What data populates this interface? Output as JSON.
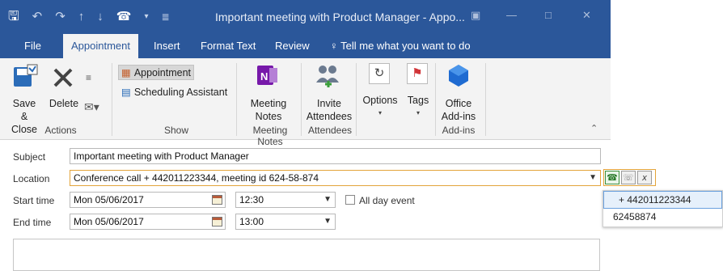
{
  "window": {
    "title": "Important meeting with Product Manager  -  Appo..."
  },
  "tabs": [
    {
      "label": "File"
    },
    {
      "label": "Appointment"
    },
    {
      "label": "Insert"
    },
    {
      "label": "Format Text"
    },
    {
      "label": "Review"
    },
    {
      "label": "Tell me what you want to do"
    }
  ],
  "ribbon": {
    "actions": {
      "save_close_line1": "Save &",
      "save_close_line2": "Close",
      "delete": "Delete",
      "group": "Actions"
    },
    "show": {
      "appointment": "Appointment",
      "scheduling": "Scheduling Assistant",
      "group": "Show"
    },
    "meeting_notes": {
      "line1": "Meeting",
      "line2": "Notes",
      "group": "Meeting Notes"
    },
    "attendees": {
      "line1": "Invite",
      "line2": "Attendees",
      "group": "Attendees"
    },
    "options": {
      "label": "Options"
    },
    "tags": {
      "label": "Tags"
    },
    "addins": {
      "line1": "Office",
      "line2": "Add-ins",
      "group": "Add-ins"
    }
  },
  "form": {
    "subject_label": "Subject",
    "subject_value": "Important meeting with Product Manager",
    "location_label": "Location",
    "location_value": "Conference call + 442011223344, meeting id 624-58-874",
    "start_label": "Start time",
    "start_date": "Mon 05/06/2017",
    "start_time": "12:30",
    "all_day_label": "All day event",
    "end_label": "End time",
    "end_date": "Mon 05/06/2017",
    "end_time": "13:00"
  },
  "dial_popup": {
    "items": [
      "+ 442011223344",
      "62458874"
    ],
    "close_label": "x"
  }
}
